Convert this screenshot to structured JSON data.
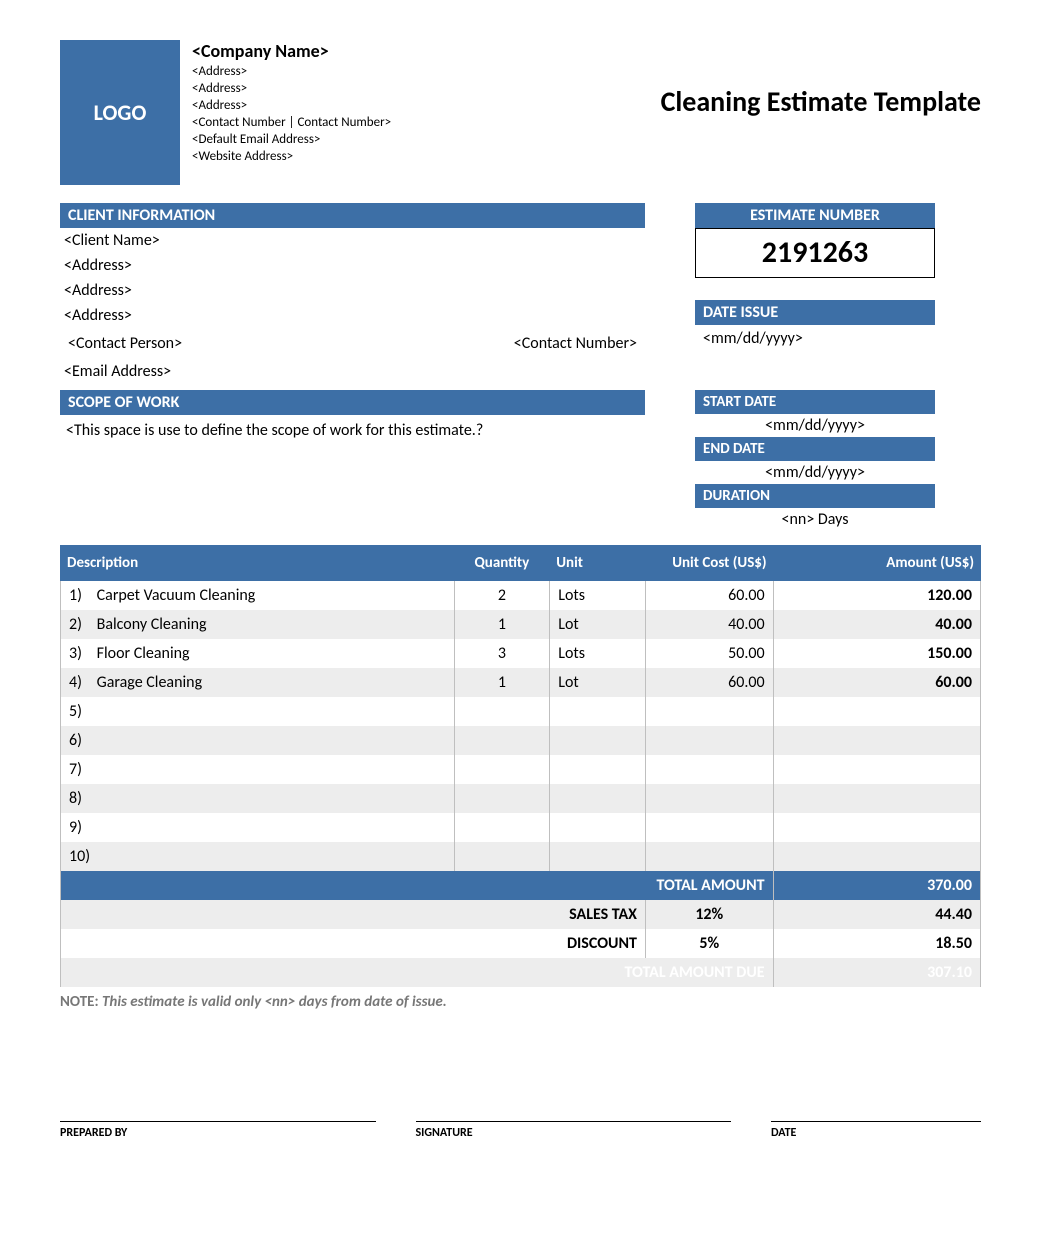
{
  "header": {
    "logo_text": "LOGO",
    "company_name": "<Company Name>",
    "company_lines": [
      "<Address>",
      "<Address>",
      "<Address>",
      "<Contact Number | Contact Number>",
      "<Default Email Address>",
      "<Website Address>"
    ],
    "doc_title": "Cleaning Estimate Template"
  },
  "client": {
    "heading": "CLIENT INFORMATION",
    "name": "<Client Name>",
    "addr1": "<Address>",
    "addr2": "<Address>",
    "addr3": "<Address>",
    "contact_person": "<Contact Person>",
    "contact_number": "<Contact Number>",
    "email": "<Email Address>"
  },
  "estimate": {
    "heading": "ESTIMATE NUMBER",
    "number": "2191263",
    "date_issue_heading": "DATE ISSUE",
    "date_issue": "<mm/dd/yyyy>"
  },
  "scope": {
    "heading": "SCOPE OF WORK",
    "body": "<This space is use to define the scope of work for this estimate.?"
  },
  "dates": {
    "start_heading": "START DATE",
    "start_value": "<mm/dd/yyyy>",
    "end_heading": "END DATE",
    "end_value": "<mm/dd/yyyy>",
    "duration_heading": "DURATION",
    "duration_value": "<nn> Days"
  },
  "table": {
    "headers": {
      "desc": "Description",
      "qty": "Quantity",
      "unit": "Unit",
      "cost": "Unit Cost (US$)",
      "amt": "Amount (US$)"
    },
    "rows": [
      {
        "n": "1)",
        "desc": "Carpet Vacuum Cleaning",
        "qty": "2",
        "unit": "Lots",
        "cost": "60.00",
        "amt": "120.00"
      },
      {
        "n": "2)",
        "desc": "Balcony Cleaning",
        "qty": "1",
        "unit": "Lot",
        "cost": "40.00",
        "amt": "40.00"
      },
      {
        "n": "3)",
        "desc": "Floor Cleaning",
        "qty": "3",
        "unit": "Lots",
        "cost": "50.00",
        "amt": "150.00"
      },
      {
        "n": "4)",
        "desc": "Garage Cleaning",
        "qty": "1",
        "unit": "Lot",
        "cost": "60.00",
        "amt": "60.00"
      },
      {
        "n": "5)",
        "desc": "",
        "qty": "",
        "unit": "",
        "cost": "",
        "amt": ""
      },
      {
        "n": "6)",
        "desc": "",
        "qty": "",
        "unit": "",
        "cost": "",
        "amt": ""
      },
      {
        "n": "7)",
        "desc": "",
        "qty": "",
        "unit": "",
        "cost": "",
        "amt": ""
      },
      {
        "n": "8)",
        "desc": "",
        "qty": "",
        "unit": "",
        "cost": "",
        "amt": ""
      },
      {
        "n": "9)",
        "desc": "",
        "qty": "",
        "unit": "",
        "cost": "",
        "amt": ""
      },
      {
        "n": "10)",
        "desc": "",
        "qty": "",
        "unit": "",
        "cost": "",
        "amt": ""
      }
    ]
  },
  "totals": {
    "total_label": "TOTAL AMOUNT",
    "total_value": "370.00",
    "tax_label": "SALES TAX",
    "tax_pct": "12%",
    "tax_value": "44.40",
    "disc_label": "DISCOUNT",
    "disc_pct": "5%",
    "disc_value": "18.50",
    "due_label": "TOTAL AMOUNT DUE",
    "due_value": "307.10"
  },
  "note": {
    "label": "NOTE:",
    "text": "This estimate is valid only <nn> days from date of issue."
  },
  "sig": {
    "prepared": "PREPARED BY",
    "signature": "SIGNATURE",
    "date": "DATE"
  }
}
